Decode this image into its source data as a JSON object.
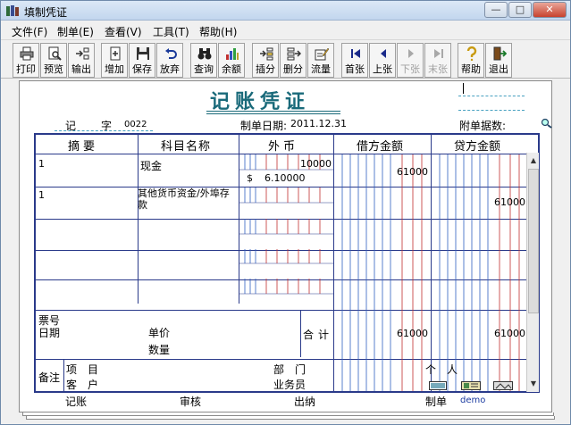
{
  "window": {
    "title": "填制凭证"
  },
  "menu": [
    {
      "label": "文件(F)"
    },
    {
      "label": "制单(E)"
    },
    {
      "label": "查看(V)"
    },
    {
      "label": "工具(T)"
    },
    {
      "label": "帮助(H)"
    }
  ],
  "toolbar": {
    "print": "打印",
    "preview": "预览",
    "export": "输出",
    "add": "增加",
    "save": "保存",
    "discard": "放弃",
    "query": "查询",
    "balance": "余额",
    "insert": "插分",
    "delete": "删分",
    "flow": "流量",
    "first": "首张",
    "prev": "上张",
    "next": "下张",
    "last": "末张",
    "help": "帮助",
    "exit": "退出"
  },
  "voucher": {
    "title": "记账凭证",
    "type_label": "记",
    "number_label": "字",
    "number": "0022",
    "date_label": "制单日期:",
    "date": "2011.12.31",
    "attachments_label": "附单据数:",
    "columns": {
      "summary": "摘要",
      "account": "科目名称",
      "foreign": "外币",
      "debit": "借方金额",
      "credit": "贷方金额"
    },
    "rows": [
      {
        "summary": "1",
        "account": "现金",
        "foreign_amount": "10000",
        "currency": "$",
        "rate": "6.10000",
        "debit": "61000",
        "credit": ""
      },
      {
        "summary": "1",
        "account": "其他货币资金/外埠存款",
        "foreign_amount": "",
        "currency": "",
        "rate": "",
        "debit": "",
        "credit": "61000"
      }
    ],
    "footer_left": {
      "ticket": "票号",
      "date": "日期",
      "unit_price": "单价",
      "quantity": "数量"
    },
    "total_label": "合计",
    "total_debit": "61000",
    "total_credit": "61000",
    "remarks_label": "备注",
    "project_label": "项目",
    "customer_label": "客户",
    "dept_label": "部门",
    "person_label": "个人",
    "salesman_label": "业务员",
    "bookkeeper_label": "记账",
    "review_label": "审核",
    "cashier_label": "出纳",
    "maker_label": "制单",
    "maker": "demo"
  }
}
